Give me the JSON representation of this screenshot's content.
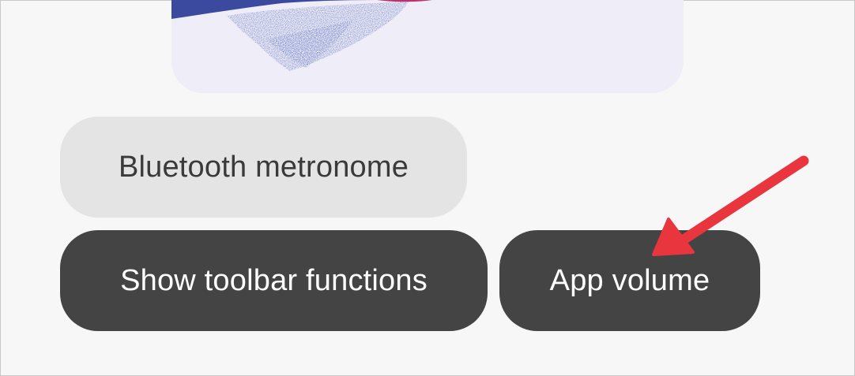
{
  "illustration": {
    "icon": "paint-splash-illustration",
    "colors": {
      "card": "#efedf7",
      "splash_primary": "#3b4a9e",
      "splash_accent": "#c0306a"
    }
  },
  "options": {
    "bluetooth_metronome": "Bluetooth metronome",
    "show_toolbar_functions": "Show toolbar functions",
    "app_volume": "App volume"
  },
  "annotation": {
    "icon": "red-arrow-icon",
    "color": "#e8353e",
    "points_to": "app_volume"
  },
  "colors": {
    "background": "#f7f7f7",
    "chip_light": "#e4e4e4",
    "chip_dark": "#444444"
  }
}
